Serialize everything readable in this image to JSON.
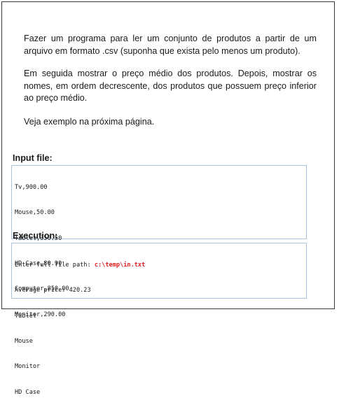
{
  "paragraphs": [
    "Fazer um programa para ler um conjunto de produtos a partir de um arquivo em formato .csv (suponha que exista pelo menos um produto).",
    "Em seguida mostrar o preço médio dos produtos. Depois, mostrar os nomes, em ordem decrescente, dos produtos que possuem preço inferior ao preço médio.",
    "Veja exemplo na próxima página."
  ],
  "input_section": {
    "title": "Input file:",
    "lines": [
      "Tv,900.00",
      "Mouse,50.00",
      "Tablet,350.50",
      "HD Case,80.90",
      "Computer,850.00",
      "Monitor,290.00"
    ]
  },
  "execution_section": {
    "title": "Execution:",
    "prompt_text": "Enter full file path: ",
    "prompt_input": "c:\\temp\\in.txt",
    "lines": [
      "Average price: 420.23",
      "Tablet",
      "Mouse",
      "Monitor",
      "HD Case"
    ]
  },
  "colors": {
    "user_input": "#e02020",
    "code_border": "#a9c4dd"
  }
}
